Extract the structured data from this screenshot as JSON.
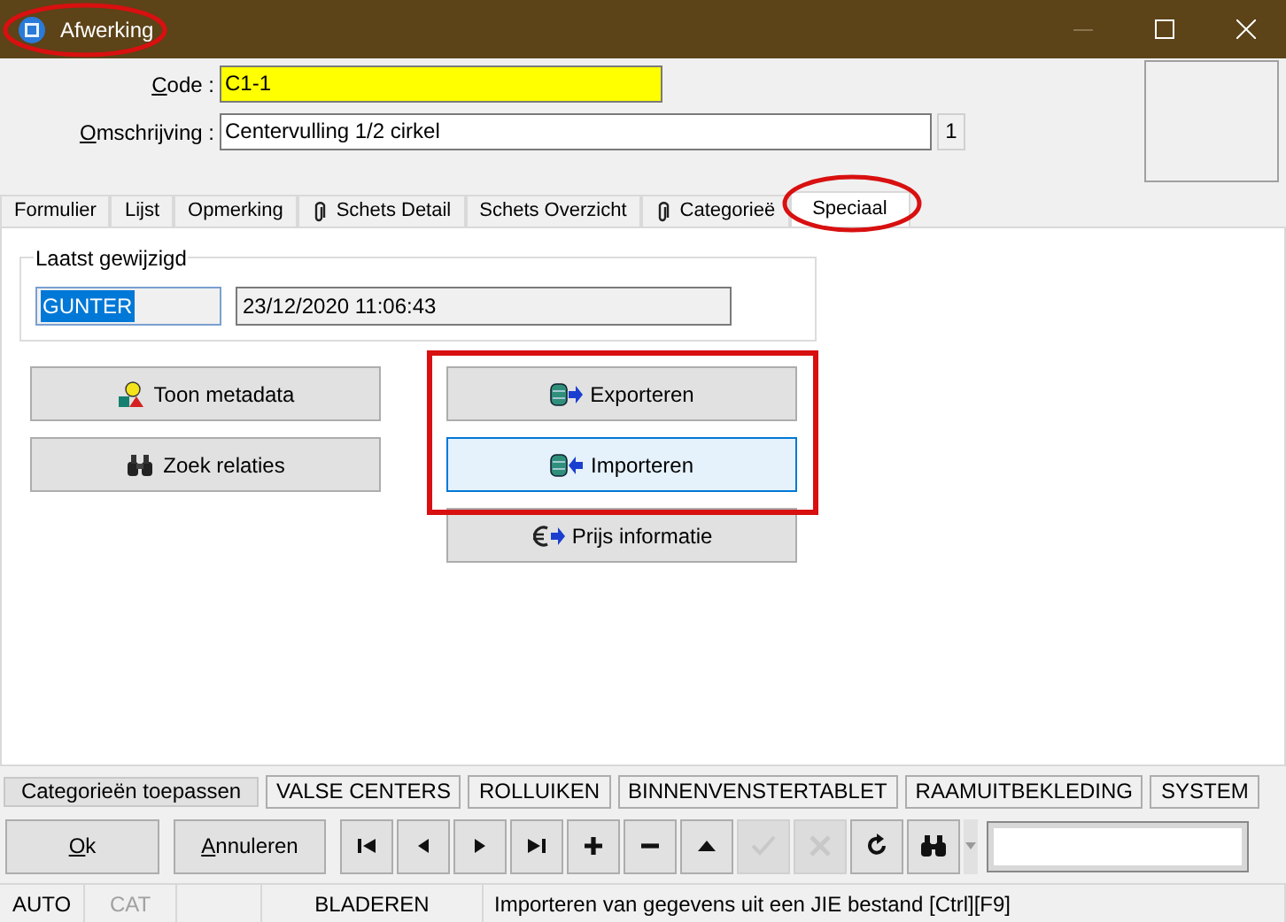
{
  "window": {
    "title": "Afwerking"
  },
  "fields": {
    "code": {
      "label": "Code :",
      "value": "C1-1"
    },
    "description": {
      "label": "Omschrijving :",
      "value": "Centervulling 1/2 cirkel",
      "count": "1"
    }
  },
  "tabs": [
    {
      "label": "Formulier",
      "selected": false,
      "attachment": false
    },
    {
      "label": "Lijst",
      "selected": false,
      "attachment": false
    },
    {
      "label": "Opmerking",
      "selected": false,
      "attachment": false
    },
    {
      "label": "Schets Detail",
      "selected": false,
      "attachment": true
    },
    {
      "label": "Schets Overzicht",
      "selected": false,
      "attachment": false
    },
    {
      "label": "Categorieë",
      "selected": false,
      "attachment": true
    },
    {
      "label": "Speciaal",
      "selected": true,
      "attachment": false
    }
  ],
  "last_modified": {
    "title": "Laatst gewijzigd",
    "user": "GUNTER",
    "timestamp": "23/12/2020 11:06:43"
  },
  "left_buttons": [
    {
      "label": "Toon metadata",
      "kind": "metadata"
    },
    {
      "label": "Zoek relaties",
      "kind": "binoculars"
    }
  ],
  "right_buttons": [
    {
      "label": "Exporteren",
      "kind": "export",
      "selected": false
    },
    {
      "label": "Importeren",
      "kind": "import",
      "selected": true
    },
    {
      "label": "Prijs informatie",
      "kind": "price",
      "selected": false
    }
  ],
  "category_bar": {
    "apply": "Categorieën toepassen",
    "categories": [
      "VALSE CENTERS",
      "ROLLUIKEN",
      "BINNENVENSTERTABLET",
      "RAAMUITBEKLEDING",
      "SYSTEM"
    ]
  },
  "toolbar": {
    "ok": "Ok",
    "cancel": "Annuleren",
    "nav": [
      {
        "kind": "first",
        "disabled": false
      },
      {
        "kind": "prev",
        "disabled": false
      },
      {
        "kind": "next",
        "disabled": false
      },
      {
        "kind": "last",
        "disabled": false
      },
      {
        "kind": "add",
        "disabled": false
      },
      {
        "kind": "remove",
        "disabled": false
      },
      {
        "kind": "up",
        "disabled": false
      },
      {
        "kind": "confirm",
        "disabled": true
      },
      {
        "kind": "discard",
        "disabled": true
      },
      {
        "kind": "refresh",
        "disabled": false
      },
      {
        "kind": "search",
        "disabled": false
      }
    ]
  },
  "status_bar": [
    {
      "text": "AUTO",
      "disabled": false
    },
    {
      "text": "CAT",
      "disabled": true
    },
    {
      "text": "BLADEREN",
      "disabled": false
    },
    {
      "text": "Importeren van gegevens uit een JIE bestand [Ctrl][F9]",
      "disabled": false
    }
  ]
}
